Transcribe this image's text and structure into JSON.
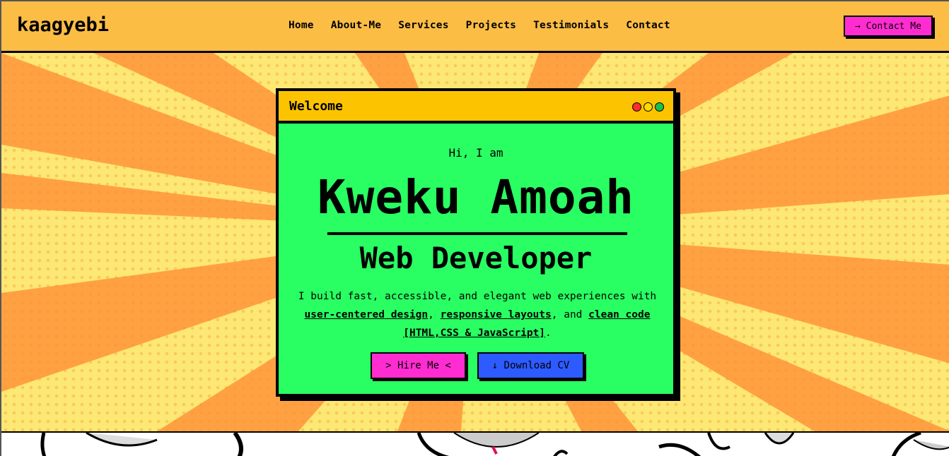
{
  "header": {
    "logo": "kaagyebi",
    "nav": [
      "Home",
      "About-Me",
      "Services",
      "Projects",
      "Testimonials",
      "Contact"
    ],
    "contact_button": "→ Contact Me"
  },
  "window": {
    "title": "Welcome",
    "greeting": "Hi, I am",
    "name": "Kweku Amoah",
    "role": "Web Developer",
    "description": {
      "part1": "I build fast, accessible, and elegant web experiences with ",
      "link1": "user-centered design",
      "sep1": ", ",
      "link2": "responsive layouts",
      "sep2": ", and ",
      "link3": "clean code [HTML,CSS & JavaScript]",
      "end": "."
    },
    "hire_button": "> Hire Me <",
    "cv_button": "↓ Download CV"
  },
  "colors": {
    "header_bg": "#fcbd45",
    "card_bg": "#29ff63",
    "titlebar_bg": "#fcc400",
    "accent_pink": "#ff2dd1",
    "accent_blue": "#2d5bff",
    "dot_red": "#ff2d2d",
    "dot_yellow": "#ffd800",
    "dot_green": "#17c24a"
  }
}
